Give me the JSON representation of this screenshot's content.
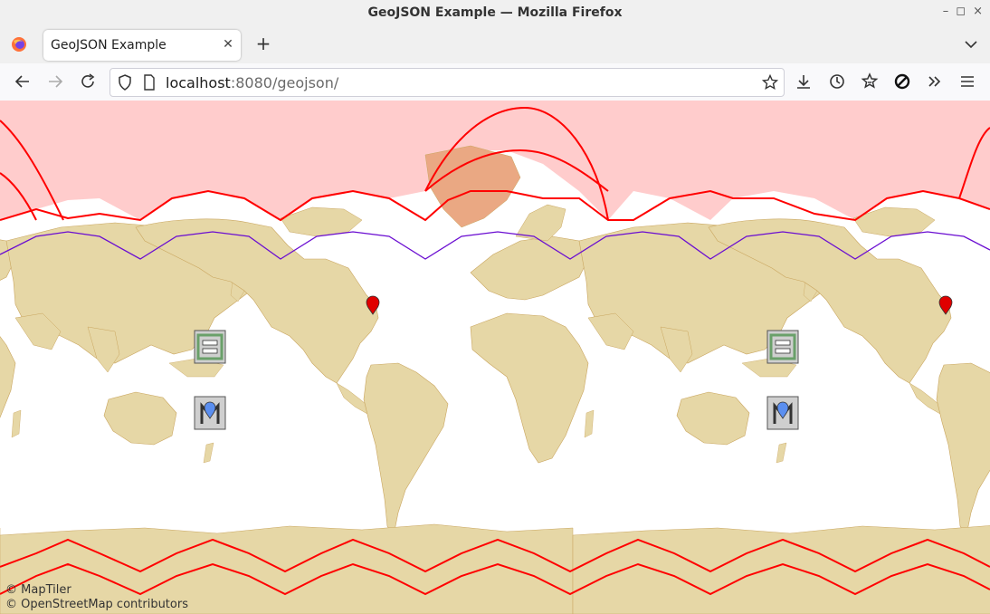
{
  "window": {
    "title": "GeoJSON Example — Mozilla Firefox"
  },
  "tabs": [
    {
      "label": "GeoJSON Example"
    }
  ],
  "url": {
    "host": "localhost",
    "rest": ":8080/geojson/"
  },
  "attribution": {
    "line1": "© MapTiler",
    "line2": "© OpenStreetMap contributors"
  },
  "icons": {
    "back": "back-arrow-icon",
    "forward": "forward-arrow-icon",
    "reload": "reload-icon",
    "shield": "tracking-shield-icon",
    "page": "page-icon",
    "bookmark": "bookmark-star-icon",
    "downloads": "downloads-icon",
    "history": "history-icon",
    "extensions": "extensions-icon",
    "blocked": "block-icon",
    "overflow": "overflow-chevron-icon",
    "menu": "hamburger-menu-icon"
  },
  "colors": {
    "land": "#e6d7a6",
    "border": "#c9a55e",
    "polar_fill": "#ffcccc",
    "polar_overlap": "#eaa883",
    "red_line": "#ff0000",
    "purple_line": "#6a0dd1",
    "marker_red": "#e00000",
    "marker_blue": "#5b8ff0"
  }
}
